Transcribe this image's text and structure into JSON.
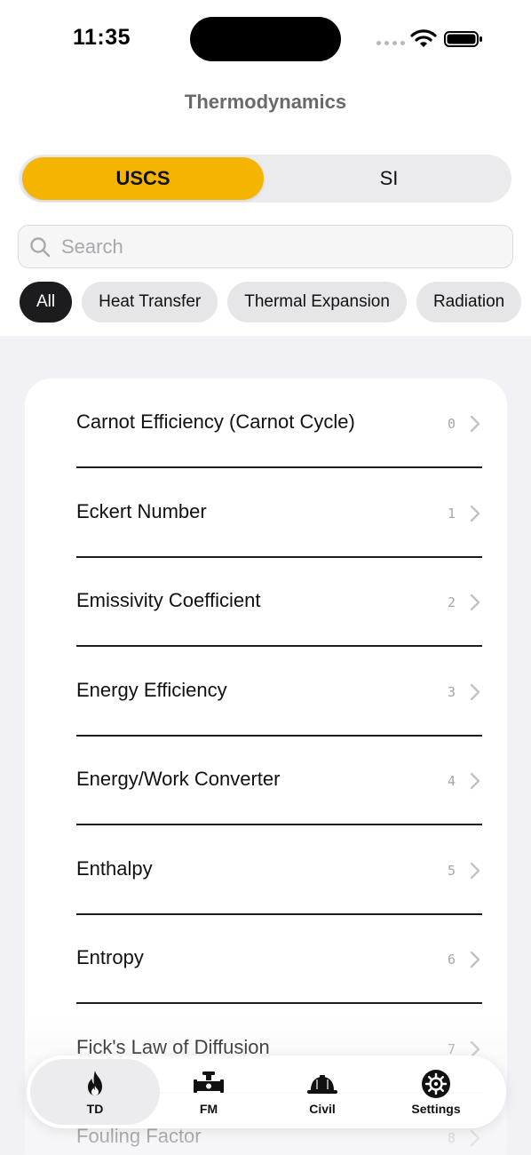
{
  "status": {
    "time": "11:35"
  },
  "header": {
    "title": "Thermodynamics"
  },
  "units": {
    "options": [
      "USCS",
      "SI"
    ],
    "selected": "USCS"
  },
  "search": {
    "placeholder": "Search",
    "value": ""
  },
  "filters": [
    {
      "label": "All",
      "active": true
    },
    {
      "label": "Heat Transfer",
      "active": false
    },
    {
      "label": "Thermal Expansion",
      "active": false
    },
    {
      "label": "Radiation",
      "active": false
    }
  ],
  "list": {
    "items": [
      {
        "label": "Carnot Efficiency (Carnot Cycle)",
        "index": "0"
      },
      {
        "label": "Eckert Number",
        "index": "1"
      },
      {
        "label": "Emissivity Coefficient",
        "index": "2"
      },
      {
        "label": "Energy Efficiency",
        "index": "3"
      },
      {
        "label": "Energy/Work Converter",
        "index": "4"
      },
      {
        "label": "Enthalpy",
        "index": "5"
      },
      {
        "label": "Entropy",
        "index": "6"
      },
      {
        "label": "Fick's Law of Diffusion",
        "index": "7"
      },
      {
        "label": "Fouling Factor",
        "index": "8"
      }
    ]
  },
  "tabs": [
    {
      "label": "TD",
      "icon": "flame-icon",
      "selected": true
    },
    {
      "label": "FM",
      "icon": "pipe-valve-icon",
      "selected": false
    },
    {
      "label": "Civil",
      "icon": "hard-hat-icon",
      "selected": false
    },
    {
      "label": "Settings",
      "icon": "gear-icon",
      "selected": false
    }
  ],
  "colors": {
    "accent": "#f4b400",
    "chip_active": "#1c1c1e",
    "background": "#f2f2f6"
  }
}
